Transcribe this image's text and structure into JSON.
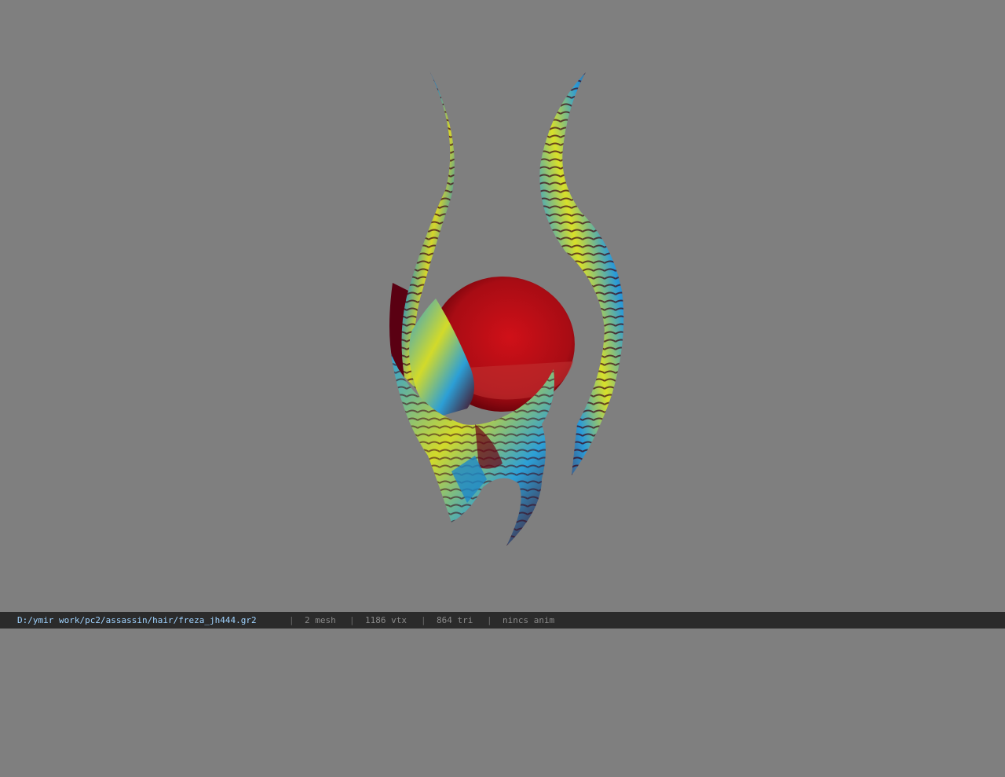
{
  "viewer": {
    "background_color": "#7f7f7f",
    "model_icon": "helmet-with-horns-model"
  },
  "status": {
    "path": "D:/ymir work/pc2/assassin/hair/freza_jh444.gr2",
    "separator": "|",
    "mesh": "2 mesh",
    "vtx": "1186 vtx",
    "tri": "864 tri",
    "anim": "nincs anim"
  }
}
